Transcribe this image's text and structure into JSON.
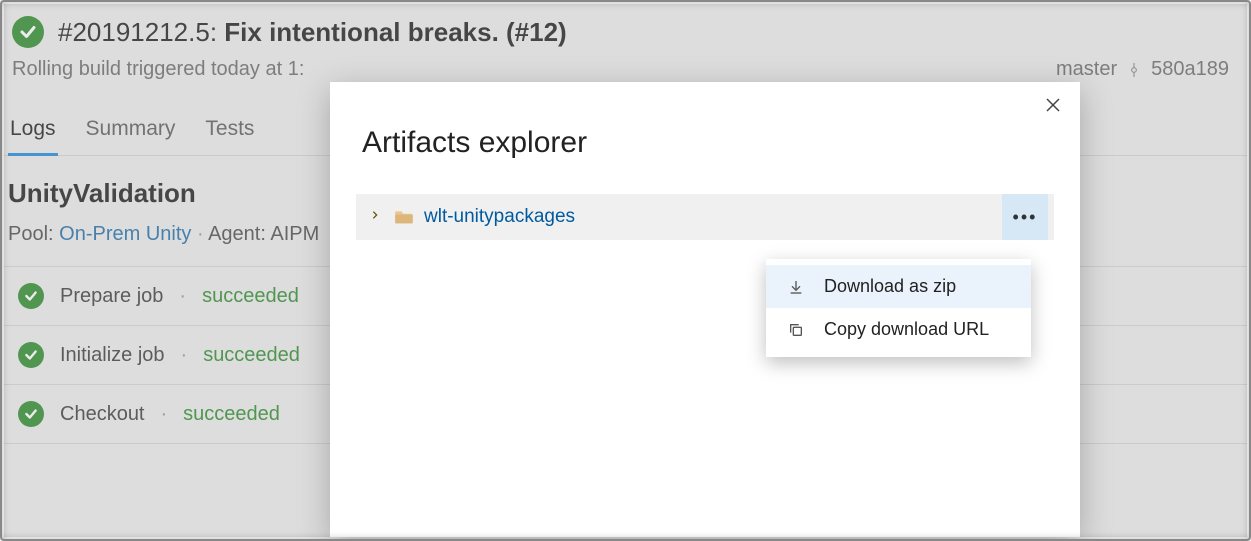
{
  "header": {
    "build_number": "#20191212.5:",
    "build_title": "Fix intentional breaks. (#12)",
    "trigger_text": "Rolling build triggered today at 1:",
    "branch": "master",
    "commit": "580a189"
  },
  "tabs": {
    "logs": "Logs",
    "summary": "Summary",
    "tests": "Tests"
  },
  "job": {
    "title": "UnityValidation",
    "pool_label": "Pool:",
    "pool_name": "On-Prem Unity",
    "agent_label": "Agent: AIPM"
  },
  "steps": [
    {
      "name": "Prepare job",
      "result": "succeeded"
    },
    {
      "name": "Initialize job",
      "result": "succeeded"
    },
    {
      "name": "Checkout",
      "result": "succeeded"
    }
  ],
  "modal": {
    "title": "Artifacts explorer",
    "artifact_name": "wlt-unitypackages",
    "more_label": "•••"
  },
  "menu": {
    "download": "Download as zip",
    "copy_url": "Copy download URL"
  }
}
